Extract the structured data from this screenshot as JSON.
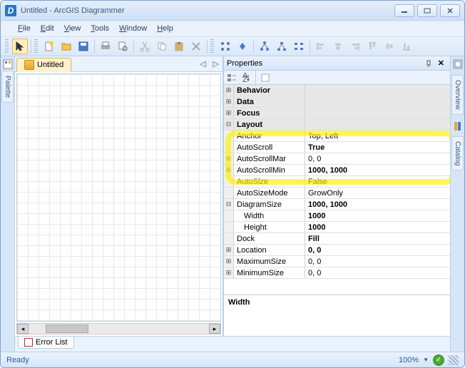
{
  "window": {
    "title": "Untitled - ArcGIS Diagrammer"
  },
  "menu": {
    "file": "File",
    "edit": "Edit",
    "view": "View",
    "tools": "Tools",
    "window": "Window",
    "help": "Help"
  },
  "doc": {
    "tab_title": "Untitled"
  },
  "sidebar": {
    "left": "Palette",
    "right1": "Overview",
    "right2": "Catalog"
  },
  "properties": {
    "header": "Properties",
    "categories": {
      "behavior": "Behavior",
      "data": "Data",
      "focus": "Focus",
      "layout": "Layout"
    },
    "rows": {
      "anchor": {
        "name": "Anchor",
        "value": "Top, Left"
      },
      "autoscroll": {
        "name": "AutoScroll",
        "value": "True"
      },
      "autoscrollmargin": {
        "name": "AutoScrollMar",
        "value": "0, 0"
      },
      "autoscrollminsize": {
        "name": "AutoScrollMin",
        "value": "1000, 1000"
      },
      "autosize": {
        "name": "AutoSize",
        "value": "False"
      },
      "autosizemode": {
        "name": "AutoSizeMode",
        "value": "GrowOnly"
      },
      "diagramsize": {
        "name": "DiagramSize",
        "value": "1000, 1000"
      },
      "width": {
        "name": "Width",
        "value": "1000"
      },
      "height": {
        "name": "Height",
        "value": "1000"
      },
      "dock": {
        "name": "Dock",
        "value": "Fill"
      },
      "location": {
        "name": "Location",
        "value": "0, 0"
      },
      "maximumsize": {
        "name": "MaximumSize",
        "value": "0, 0"
      },
      "minimumsize": {
        "name": "MinimumSize",
        "value": "0, 0"
      }
    },
    "help": {
      "name": "Width",
      "desc": ""
    }
  },
  "bottom": {
    "errorlist": "Error List"
  },
  "status": {
    "ready": "Ready",
    "zoom": "100%"
  }
}
